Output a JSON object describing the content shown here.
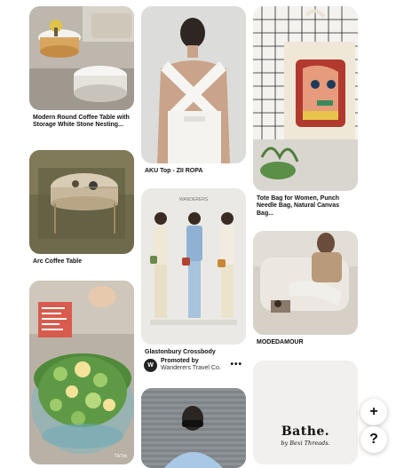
{
  "pins": [
    {
      "id": "coffee-table-round",
      "title": "Modern Round Coffee Table with Storage White Stone Nesting..."
    },
    {
      "id": "arc-coffee-table",
      "title": "Arc Coffee Table"
    },
    {
      "id": "cucumber-salad",
      "title": "",
      "watermark": "TikTok"
    },
    {
      "id": "aku-top",
      "title": "AKU Top - ZII ROPA"
    },
    {
      "id": "glastonbury",
      "title": "Glastonbury Crossbody",
      "brand_caption": "WANDERERS",
      "promoted_label": "Promoted by",
      "advertiser": "Wanderers Travel Co.",
      "avatar_letter": "W",
      "more": "•••"
    },
    {
      "id": "blue-shirt",
      "title": ""
    },
    {
      "id": "tote-bag",
      "title": "Tote Bag for Women, Punch Needle Bag, Natural Canvas Bag..."
    },
    {
      "id": "modedamour",
      "title": "MODEDAMOUR"
    },
    {
      "id": "bathe",
      "title": "",
      "logo": "Bathe.",
      "logo_sub": "by Bexi Threads."
    }
  ],
  "fab": {
    "add": "+",
    "help": "?"
  },
  "icons": {
    "add": "plus-icon",
    "help": "question-icon",
    "more": "more-dots-icon"
  }
}
